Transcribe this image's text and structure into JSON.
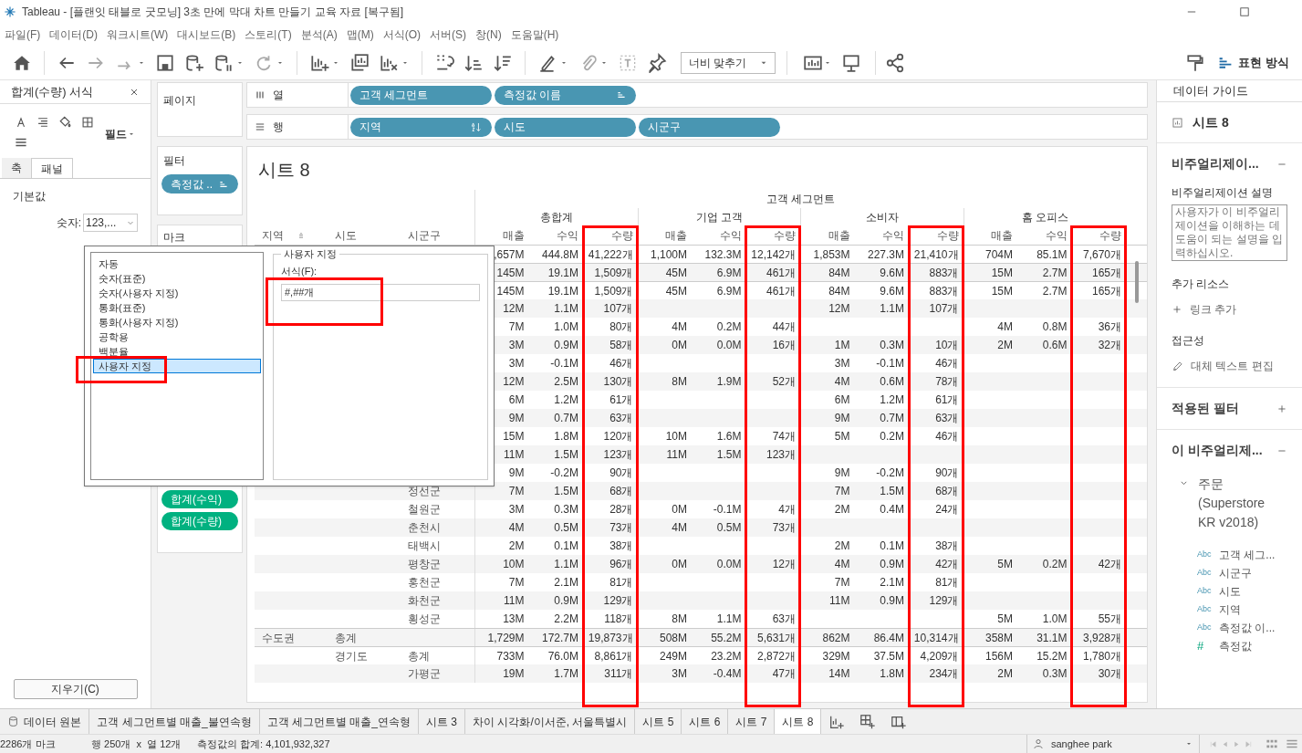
{
  "window": {
    "title": "Tableau - [플랜잇 태블로 굿모닝] 3초 만에 막대 차트 만들기 교육 자료 [복구됨]"
  },
  "menu": [
    "파일(F)",
    "데이터(D)",
    "워크시트(W)",
    "대시보드(B)",
    "스토리(T)",
    "분석(A)",
    "맵(M)",
    "서식(O)",
    "서버(S)",
    "창(N)",
    "도움말(H)"
  ],
  "toolbar": {
    "fit": "너비 맞추기",
    "show_me": "표현 방식"
  },
  "format_pane": {
    "title": "합계(수량) 서식",
    "scope": "필드",
    "tabs": [
      {
        "label": "축",
        "selected": false
      },
      {
        "label": "패널",
        "selected": true
      }
    ],
    "section": "기본값",
    "number_label": "숫자:",
    "number_value": "123,...",
    "clear_button": "지우기(C)"
  },
  "cards": {
    "pages": "페이지",
    "filters": "필터",
    "filter_pills": [
      {
        "label": "측정값 ..",
        "kind": "measure_names"
      }
    ],
    "marks": "마크",
    "mark_pills": [
      "합계(수익)",
      "합계(수량)"
    ]
  },
  "shelves": {
    "columns": {
      "label": "열",
      "pills": [
        {
          "label": "고객 세그먼트",
          "kind": "plain"
        },
        {
          "label": "측정값 이름",
          "kind": "measure_names"
        }
      ]
    },
    "rows": {
      "label": "행",
      "pills": [
        {
          "label": "지역",
          "kind": "sorted"
        },
        {
          "label": "시도",
          "kind": "plain"
        },
        {
          "label": "시군구",
          "kind": "plain"
        }
      ]
    }
  },
  "sheet": {
    "title": "시트 8",
    "top_header": "고객 세그먼트",
    "row_headers": [
      "지역",
      "시도",
      "시군구"
    ],
    "groups": [
      {
        "name": "총합계",
        "measures": [
          "매출",
          "수익",
          "수량"
        ]
      },
      {
        "name": "기업 고객",
        "measures": [
          "매출",
          "수익",
          "수량"
        ]
      },
      {
        "name": "소비자",
        "measures": [
          "매출",
          "수익",
          "수량"
        ]
      },
      {
        "name": "홈 오피스",
        "measures": [
          "매출",
          "수익",
          "수량"
        ]
      }
    ],
    "rows": [
      {
        "kind": "total",
        "cells": [
          ",657M",
          "444.8M",
          "41,222개",
          "1,100M",
          "132.3M",
          "12,142개",
          "1,853M",
          "227.3M",
          "21,410개",
          "704M",
          "85.1M",
          "7,670개"
        ]
      },
      {
        "kind": "total",
        "cells": [
          "145M",
          "19.1M",
          "1,509개",
          "45M",
          "6.9M",
          "461개",
          "84M",
          "9.6M",
          "883개",
          "15M",
          "2.7M",
          "165개"
        ]
      },
      {
        "kind": "total",
        "cells": [
          "145M",
          "19.1M",
          "1,509개",
          "45M",
          "6.9M",
          "461개",
          "84M",
          "9.6M",
          "883개",
          "15M",
          "2.7M",
          "165개"
        ]
      },
      {
        "kind": "detail",
        "cells": [
          "12M",
          "1.1M",
          "107개",
          null,
          null,
          null,
          "12M",
          "1.1M",
          "107개",
          null,
          null,
          null
        ]
      },
      {
        "kind": "detail",
        "cells": [
          "7M",
          "1.0M",
          "80개",
          "4M",
          "0.2M",
          "44개",
          null,
          null,
          null,
          "4M",
          "0.8M",
          "36개"
        ]
      },
      {
        "kind": "detail",
        "cells": [
          "3M",
          "0.9M",
          "58개",
          "0M",
          "0.0M",
          "16개",
          "1M",
          "0.3M",
          "10개",
          "2M",
          "0.6M",
          "32개"
        ]
      },
      {
        "kind": "detail",
        "cells": [
          "3M",
          "-0.1M",
          "46개",
          null,
          null,
          null,
          "3M",
          "-0.1M",
          "46개",
          null,
          null,
          null
        ]
      },
      {
        "kind": "detail",
        "cells": [
          "12M",
          "2.5M",
          "130개",
          "8M",
          "1.9M",
          "52개",
          "4M",
          "0.6M",
          "78개",
          null,
          null,
          null
        ]
      },
      {
        "kind": "detail",
        "cells": [
          "6M",
          "1.2M",
          "61개",
          null,
          null,
          null,
          "6M",
          "1.2M",
          "61개",
          null,
          null,
          null
        ]
      },
      {
        "kind": "detail",
        "cells": [
          "9M",
          "0.7M",
          "63개",
          null,
          null,
          null,
          "9M",
          "0.7M",
          "63개",
          null,
          null,
          null
        ]
      },
      {
        "kind": "detail",
        "cells": [
          "15M",
          "1.8M",
          "120개",
          "10M",
          "1.6M",
          "74개",
          "5M",
          "0.2M",
          "46개",
          null,
          null,
          null
        ]
      },
      {
        "kind": "detail",
        "cells": [
          "11M",
          "1.5M",
          "123개",
          "11M",
          "1.5M",
          "123개",
          null,
          null,
          null,
          null,
          null,
          null
        ]
      },
      {
        "kind": "detail",
        "cells": [
          "9M",
          "-0.2M",
          "90개",
          null,
          null,
          null,
          "9M",
          "-0.2M",
          "90개",
          null,
          null,
          null
        ]
      },
      {
        "kind": "detail",
        "sigungu": "정선군",
        "cells": [
          "7M",
          "1.5M",
          "68개",
          null,
          null,
          null,
          "7M",
          "1.5M",
          "68개",
          null,
          null,
          null
        ]
      },
      {
        "kind": "detail",
        "sigungu": "철원군",
        "cells": [
          "3M",
          "0.3M",
          "28개",
          "0M",
          "-0.1M",
          "4개",
          "2M",
          "0.4M",
          "24개",
          null,
          null,
          null
        ]
      },
      {
        "kind": "detail",
        "sigungu": "춘천시",
        "cells": [
          "4M",
          "0.5M",
          "73개",
          "4M",
          "0.5M",
          "73개",
          null,
          null,
          null,
          null,
          null,
          null
        ]
      },
      {
        "kind": "detail",
        "sigungu": "태백시",
        "cells": [
          "2M",
          "0.1M",
          "38개",
          null,
          null,
          null,
          "2M",
          "0.1M",
          "38개",
          null,
          null,
          null
        ]
      },
      {
        "kind": "detail",
        "sigungu": "평창군",
        "cells": [
          "10M",
          "1.1M",
          "96개",
          "0M",
          "0.0M",
          "12개",
          "4M",
          "0.9M",
          "42개",
          "5M",
          "0.2M",
          "42개"
        ]
      },
      {
        "kind": "detail",
        "sigungu": "홍천군",
        "cells": [
          "7M",
          "2.1M",
          "81개",
          null,
          null,
          null,
          "7M",
          "2.1M",
          "81개",
          null,
          null,
          null
        ]
      },
      {
        "kind": "detail",
        "sigungu": "화천군",
        "cells": [
          "11M",
          "0.9M",
          "129개",
          null,
          null,
          null,
          "11M",
          "0.9M",
          "129개",
          null,
          null,
          null
        ]
      },
      {
        "kind": "detail",
        "sigungu": "횡성군",
        "cells": [
          "13M",
          "2.2M",
          "118개",
          "8M",
          "1.1M",
          "63개",
          null,
          null,
          null,
          "5M",
          "1.0M",
          "55개"
        ]
      },
      {
        "kind": "total",
        "region": "수도권",
        "sido": "총계",
        "cells": [
          "1,729M",
          "172.7M",
          "19,873개",
          "508M",
          "55.2M",
          "5,631개",
          "862M",
          "86.4M",
          "10,314개",
          "358M",
          "31.1M",
          "3,928개"
        ]
      },
      {
        "kind": "total",
        "sido": "경기도",
        "sigungu": "총계",
        "cells": [
          "733M",
          "76.0M",
          "8,861개",
          "249M",
          "23.2M",
          "2,872개",
          "329M",
          "37.5M",
          "4,209개",
          "156M",
          "15.2M",
          "1,780개"
        ]
      },
      {
        "kind": "detail",
        "sigungu": "가평군",
        "cells": [
          "19M",
          "1.7M",
          "311개",
          "3M",
          "-0.4M",
          "47개",
          "14M",
          "1.8M",
          "234개",
          "2M",
          "0.3M",
          "30개"
        ]
      }
    ]
  },
  "format_dialog": {
    "options": [
      {
        "label": "자동",
        "selected": false
      },
      {
        "label": "숫자(표준)",
        "selected": false
      },
      {
        "label": "숫자(사용자 지정)",
        "selected": false
      },
      {
        "label": "통화(표준)",
        "selected": false
      },
      {
        "label": "통화(사용자 지정)",
        "selected": false
      },
      {
        "label": "공학용",
        "selected": false
      },
      {
        "label": "백분율",
        "selected": false
      },
      {
        "label": "사용자 지정",
        "selected": true
      }
    ],
    "group_title": "사용자 지정",
    "format_label": "서식(F):",
    "format_value": "#,##개"
  },
  "data_guide": {
    "title": "데이터 가이드",
    "sheet": "시트 8",
    "viz_section": "비주얼리제이...",
    "desc_label": "비주얼리제이션 설명",
    "desc_placeholder": "사용자가 이 비주얼리제이션을 이해하는 데 도움이 되는 설명을 입력하십시오.",
    "resources_label": "추가 리소스",
    "add_link": "링크 추가",
    "accessibility_label": "접근성",
    "alt_text": "대체 텍스트 편집",
    "filters_section": "적용된 필터",
    "fields_section": "이 비주얼리제...",
    "source": {
      "name": "주문 (Superstore KR v2018)",
      "expanded": true,
      "fields": [
        {
          "kind": "dimension",
          "badge": "Abc",
          "name": "고객 세그..."
        },
        {
          "kind": "dimension",
          "badge": "Abc",
          "name": "시군구"
        },
        {
          "kind": "dimension",
          "badge": "Abc",
          "name": "시도"
        },
        {
          "kind": "dimension",
          "badge": "Abc",
          "name": "지역"
        },
        {
          "kind": "dimension",
          "badge": "Abc",
          "name": "측정값 이..."
        },
        {
          "kind": "measure",
          "badge": "#",
          "name": "측정값"
        }
      ]
    }
  },
  "sheet_tabs": [
    {
      "label": "데이터 원본",
      "kind": "datasource",
      "selected": false
    },
    {
      "label": "고객 세그먼트별 매출_불연속형",
      "kind": "sheet",
      "selected": false
    },
    {
      "label": "고객 세그먼트별 매출_연속형",
      "kind": "sheet",
      "selected": false
    },
    {
      "label": "시트 3",
      "kind": "sheet",
      "selected": false
    },
    {
      "label": "차이 시각화/이서준, 서울특별시",
      "kind": "sheet",
      "selected": false
    },
    {
      "label": "시트 5",
      "kind": "sheet",
      "selected": false
    },
    {
      "label": "시트 6",
      "kind": "sheet",
      "selected": false
    },
    {
      "label": "시트 7",
      "kind": "sheet",
      "selected": false
    },
    {
      "label": "시트 8",
      "kind": "sheet",
      "selected": true
    }
  ],
  "status_bar": {
    "marks": "2286개 마크",
    "dims": "행 250개  x  열 12개",
    "sum": "측정값의 합계: 4,101,932,327",
    "user": "sanghee park"
  }
}
